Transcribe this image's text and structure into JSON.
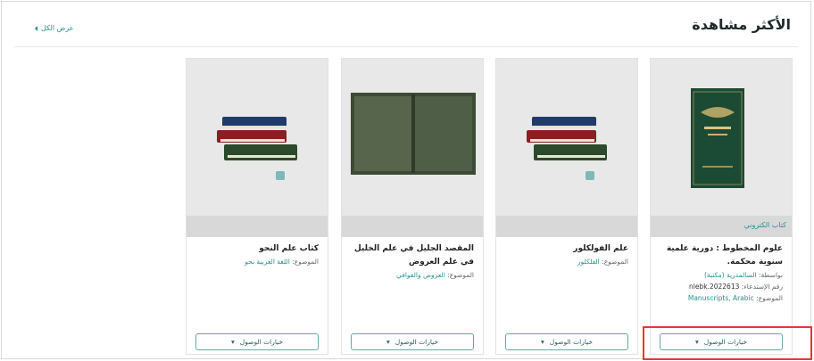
{
  "header": {
    "title": "الأكثر مشاهدة",
    "show_all": "عرض الكل",
    "show_all_icon": "chevron-left-icon"
  },
  "cards": [
    {
      "tag": "كتاب الكتروني",
      "title": "علوم المخطوط : دورية علمية سنوية محكمة.",
      "by_label": "بواسطة:",
      "by_value": "السالمدرية (مكتبة)",
      "call_label": "رقم الإستدعاء:",
      "call_value": "nlebk.2022613",
      "subject_label": "الموضوع:",
      "subject_value": "Manuscripts, Arabic",
      "access_label": "خيارات الوصول",
      "image": "green-book-cover"
    },
    {
      "title": "علم الفولكلور",
      "subject_label": "الموضوع:",
      "subject_value": "الفلكلور",
      "access_label": "خيارات الوصول",
      "image": "book-stack-placeholder"
    },
    {
      "title": "المقصد الجليل في علم الخليل في علم العروض",
      "subject_label": "الموضوع:",
      "subject_value": "العروض والقوافي",
      "access_label": "خيارات الوصول",
      "image": "open-old-book"
    },
    {
      "title": "كتاب علم النحو",
      "subject_label": "الموضوع:",
      "subject_value": "اللغة العربية نحو",
      "access_label": "خيارات الوصول",
      "image": "book-stack-placeholder"
    }
  ],
  "colors": {
    "accent": "#2a8f8f",
    "highlight": "#e53935",
    "card_image_bg": "#e8e8e8"
  }
}
